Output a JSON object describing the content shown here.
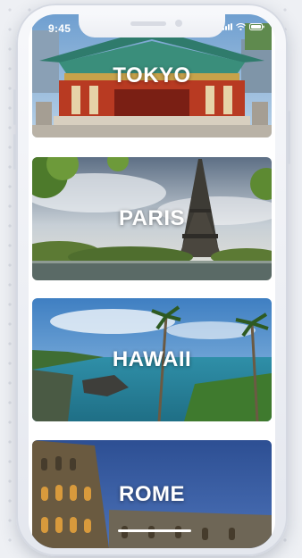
{
  "status_bar": {
    "time": "9:45",
    "icons": [
      "signal-icon",
      "wifi-icon",
      "battery-icon"
    ]
  },
  "destinations": [
    {
      "name": "TOKYO",
      "scene": "shrine"
    },
    {
      "name": "PARIS",
      "scene": "eiffel-tower"
    },
    {
      "name": "HAWAII",
      "scene": "coastline-palms"
    },
    {
      "name": "ROME",
      "scene": "colosseum"
    }
  ],
  "colors": {
    "title": "#ffffff",
    "phone_frame": "#f2f4f8",
    "screen_bg": "#ffffff"
  }
}
